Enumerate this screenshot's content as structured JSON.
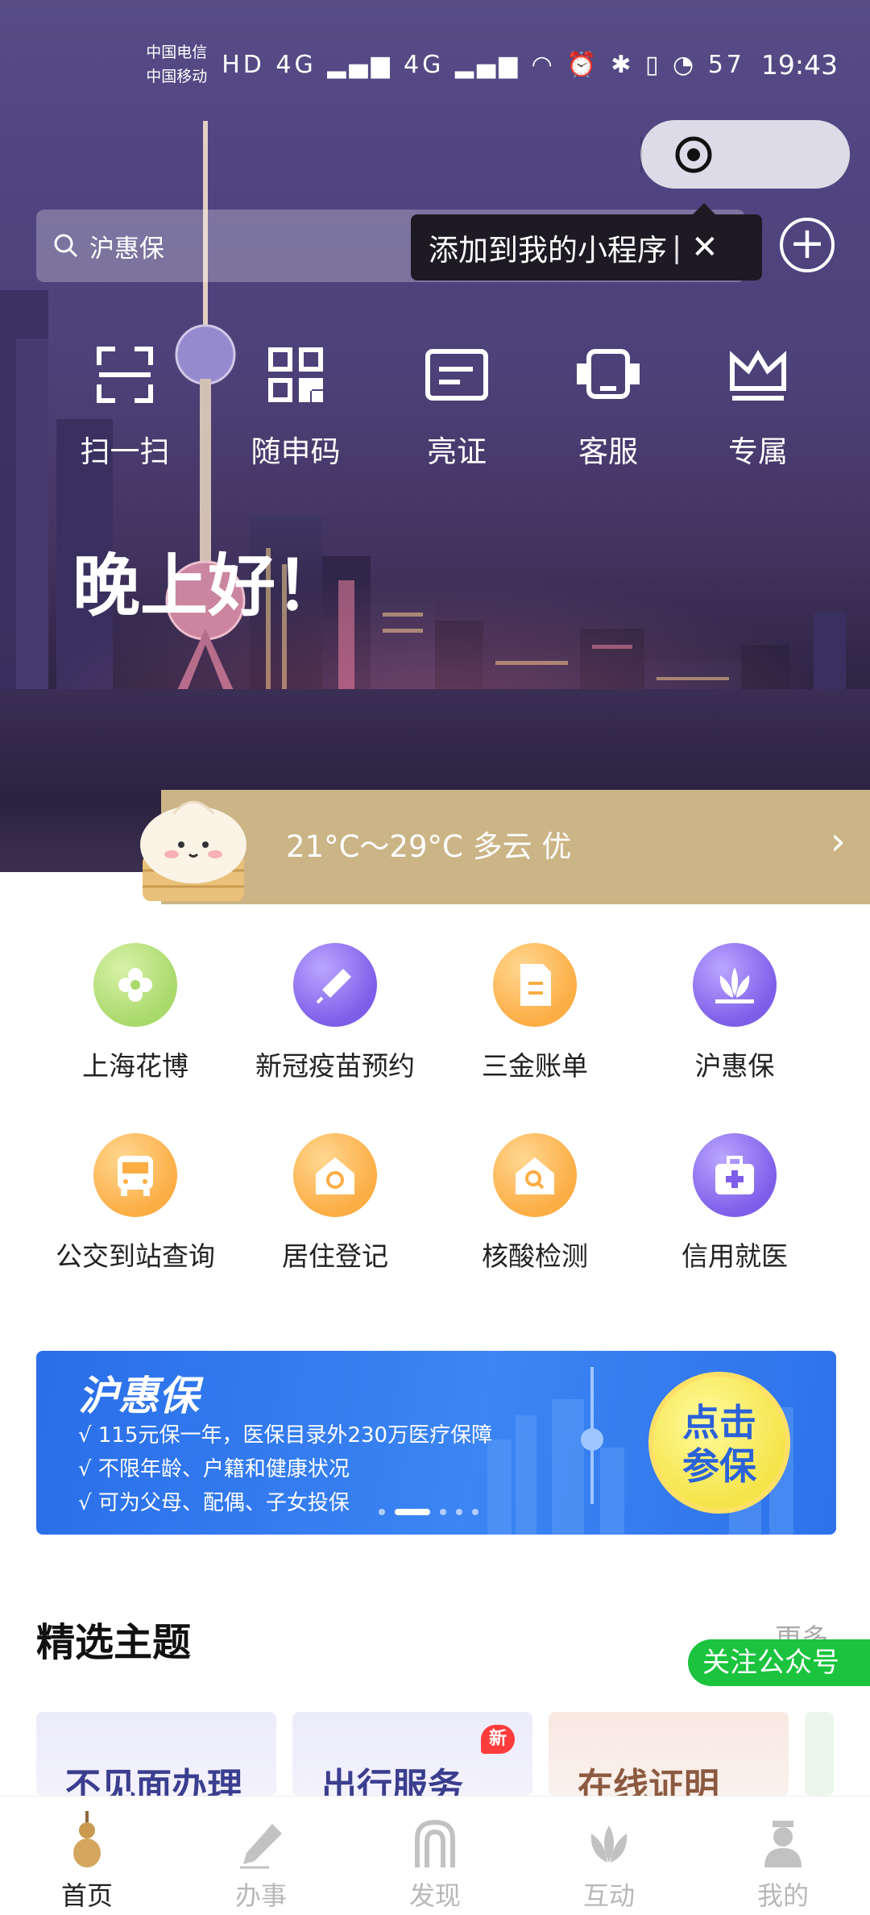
{
  "status_bar": {
    "carrier1": "中国电信",
    "carrier2": "中国移动",
    "icons": "HD 4G ▂▄▆ 4G ▂▄▆ ◠ ⏰ ✱ ▯ ◔ 57",
    "time": "19:43"
  },
  "capsule": {
    "more": "•••"
  },
  "search": {
    "text": "沪惠保"
  },
  "tooltip": {
    "text": "添加到我的小程序",
    "close": "✕"
  },
  "quick_actions": [
    {
      "label": "扫一扫"
    },
    {
      "label": "随申码"
    },
    {
      "label": "亮证"
    },
    {
      "label": "客服"
    },
    {
      "label": "专属"
    }
  ],
  "greeting": "晚上好！",
  "weather": {
    "text": "21°C～29°C 多云 优"
  },
  "services": [
    {
      "label": "上海花博",
      "color": "green"
    },
    {
      "label": "新冠疫苗预约",
      "color": "purple"
    },
    {
      "label": "三金账单",
      "color": "orange"
    },
    {
      "label": "沪惠保",
      "color": "purple"
    },
    {
      "label": "公交到站查询",
      "color": "orange"
    },
    {
      "label": "居住登记",
      "color": "orange"
    },
    {
      "label": "核酸检测",
      "color": "orange"
    },
    {
      "label": "信用就医",
      "color": "purple"
    }
  ],
  "banner": {
    "title": "沪惠保",
    "lines": [
      "√ 115元保一年，医保目录外230万医疗保障",
      "√ 不限年龄、户籍和健康状况",
      "√ 可为父母、配偶、子女投保"
    ],
    "cta_line1": "点击",
    "cta_line2": "参保"
  },
  "featured": {
    "title": "精选主题",
    "more": "更多",
    "follow": "关注公众号",
    "cards": [
      {
        "label": "不见面办理",
        "badge": ""
      },
      {
        "label": "出行服务",
        "badge": "新"
      },
      {
        "label": "在线证明",
        "badge": ""
      }
    ]
  },
  "tabs": [
    {
      "label": "首页",
      "active": true
    },
    {
      "label": "办事",
      "active": false
    },
    {
      "label": "发现",
      "active": false
    },
    {
      "label": "互动",
      "active": false
    },
    {
      "label": "我的",
      "active": false
    }
  ],
  "colors": {
    "weather_bar": "#cbb486",
    "banner_blue": "#3b85f4",
    "follow_green": "#1bc33e",
    "tab_active": "#222222",
    "tab_inactive": "#b8b8b8"
  }
}
